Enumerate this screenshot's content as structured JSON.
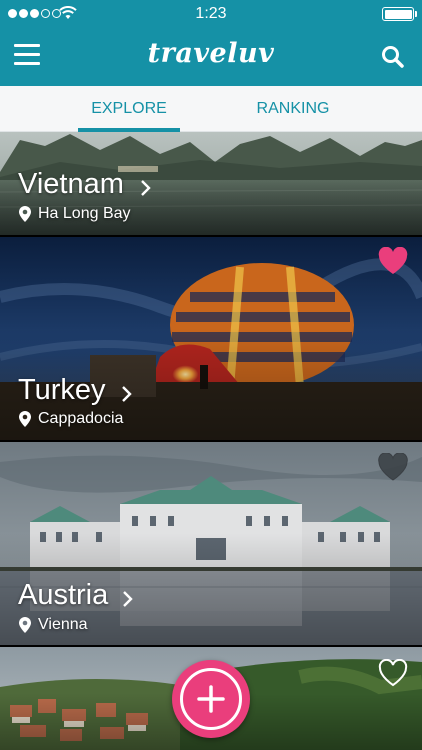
{
  "status_bar": {
    "time": "1:23",
    "signal_icon": "signal-dots-icon",
    "wifi_icon": "wifi-icon",
    "battery_icon": "battery-icon"
  },
  "header": {
    "app_title": "traveluv",
    "menu_icon": "hamburger-menu-icon",
    "search_icon": "search-icon",
    "background_color": "#1591a6"
  },
  "tabs": [
    {
      "label": "EXPLORE",
      "active": true
    },
    {
      "label": "RANKING",
      "active": false
    }
  ],
  "destinations": [
    {
      "country": "Vietnam",
      "place": "Ha Long Bay",
      "favorited": null
    },
    {
      "country": "Turkey",
      "place": "Cappadocia",
      "favorited": true
    },
    {
      "country": "Austria",
      "place": "Vienna",
      "favorited": false
    },
    {
      "country": "",
      "place": "",
      "favorited": false
    }
  ],
  "fab": {
    "icon": "plus-icon",
    "color": "#ea3e7c"
  },
  "colors": {
    "accent": "#1591a6",
    "favorite": "#ea3e7c"
  }
}
